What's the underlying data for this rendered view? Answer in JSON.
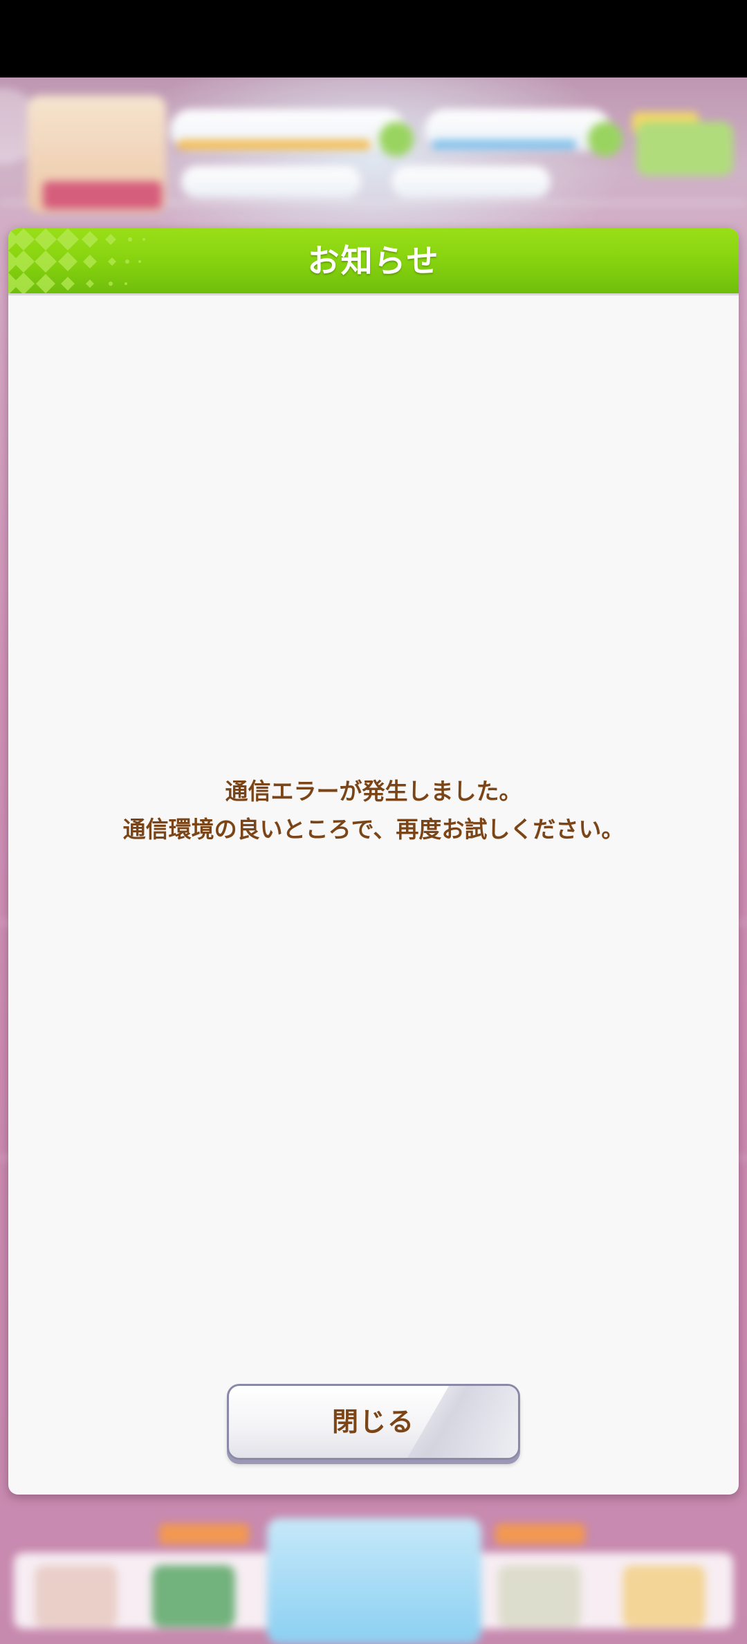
{
  "dialog": {
    "title": "お知らせ",
    "message_lines": [
      "通信エラーが発生しました。",
      "通信環境の良いところで、再度お試しください。"
    ],
    "close_label": "閉じる"
  },
  "colors": {
    "header_green": "#85d10f",
    "message_brown": "#7b4517",
    "dialog_bg": "#f8f8f8"
  }
}
